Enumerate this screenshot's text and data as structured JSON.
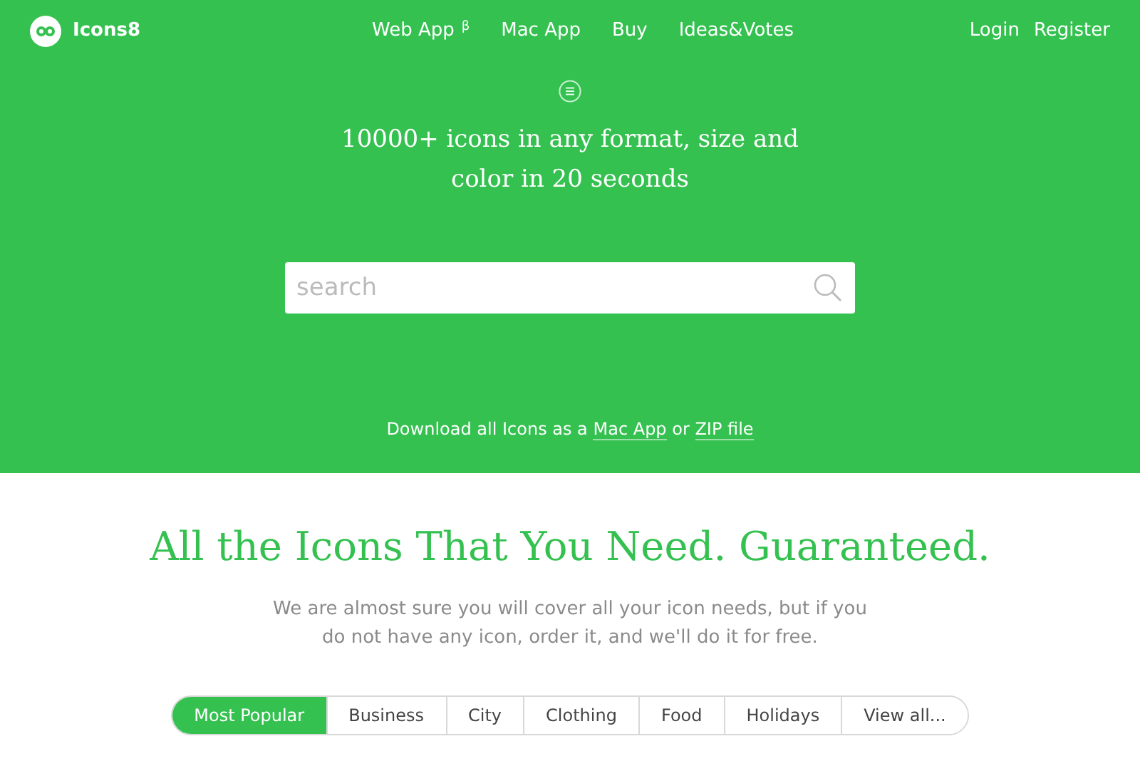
{
  "brand": {
    "name": "Icons8"
  },
  "nav": [
    {
      "label": "Web App",
      "sup": "β"
    },
    {
      "label": "Mac App"
    },
    {
      "label": "Buy"
    },
    {
      "label": "Ideas&Votes"
    }
  ],
  "account": [
    "Login",
    "Register"
  ],
  "hero": {
    "title_lines": [
      "10000+ icons in any format, size and",
      "color in 20 seconds"
    ]
  },
  "search": {
    "placeholder": "search"
  },
  "download": [
    {
      "kind": "text",
      "text": "Download all Icons as a "
    },
    {
      "kind": "link",
      "text": "Mac App"
    },
    {
      "kind": "text",
      "text": " or "
    },
    {
      "kind": "link",
      "text": "ZIP file"
    }
  ],
  "section": {
    "title": "All the Icons That You Need. Guaranteed.",
    "description": "We are almost sure you will cover all your icon needs, but if you do not have any icon, order it, and we'll do it for free."
  },
  "categories": [
    {
      "label": "Most Popular",
      "selected": true
    },
    {
      "label": "Business",
      "selected": false
    },
    {
      "label": "City",
      "selected": false
    },
    {
      "label": "Clothing",
      "selected": false
    },
    {
      "label": "Food",
      "selected": false
    },
    {
      "label": "Holidays",
      "selected": false
    },
    {
      "label": "View all...",
      "selected": false
    }
  ]
}
